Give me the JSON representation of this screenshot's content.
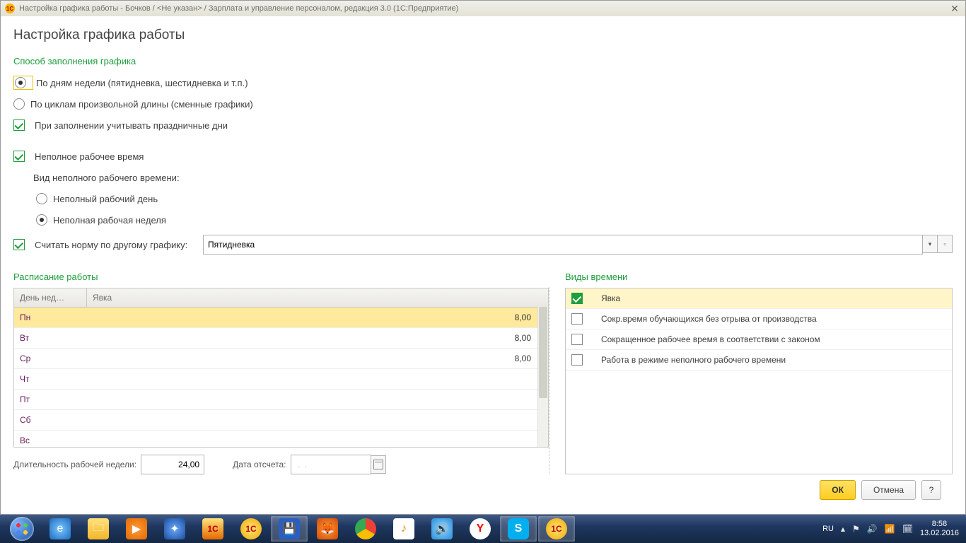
{
  "titlebar": "Настройка графика работы - Бочков / <Не указан> / Зарплата и управление персоналом, редакция 3.0  (1С:Предприятие)",
  "page_title": "Настройка графика работы",
  "section_fill": "Способ заполнения графика",
  "radio_byweekdays": "По дням недели (пятидневка, шестидневка и т.п.)",
  "radio_bycycles": "По циклам произвольной длины (сменные графики)",
  "chk_holidays": "При заполнении учитывать праздничные дни",
  "chk_parttime": "Неполное рабочее время",
  "lbl_parttime_kind": "Вид неполного рабочего времени:",
  "radio_partday": "Неполный рабочий день",
  "radio_partweek": "Неполная рабочая неделя",
  "chk_norm_label": "Считать норму по другому графику:",
  "norm_select_value": "Пятидневка",
  "section_schedule": "Расписание работы",
  "section_timetypes": "Виды времени",
  "schedule_col1": "День нед…",
  "schedule_col2": "Явка",
  "days": [
    {
      "d": "Пн",
      "v": "8,00"
    },
    {
      "d": "Вт",
      "v": "8,00"
    },
    {
      "d": "Ср",
      "v": "8,00"
    },
    {
      "d": "Чт",
      "v": ""
    },
    {
      "d": "Пт",
      "v": ""
    },
    {
      "d": "Сб",
      "v": ""
    },
    {
      "d": "Вс",
      "v": ""
    }
  ],
  "timetypes": [
    {
      "checked": true,
      "label": "Явка"
    },
    {
      "checked": false,
      "label": "Сокр.время обучающихся без отрыва от производства"
    },
    {
      "checked": false,
      "label": "Сокращенное рабочее время в соответствии с законом"
    },
    {
      "checked": false,
      "label": "Работа в режиме неполного рабочего времени"
    }
  ],
  "lbl_weeklen": "Длительность рабочей недели:",
  "weeklen_value": "24,00",
  "lbl_refdate": "Дата отсчета:",
  "refdate_value": " .  .    ",
  "btn_ok": "ОК",
  "btn_cancel": "Отмена",
  "btn_help": "?",
  "tray_lang": "RU",
  "tray_time": "8:58",
  "tray_date": "13.02.2016"
}
